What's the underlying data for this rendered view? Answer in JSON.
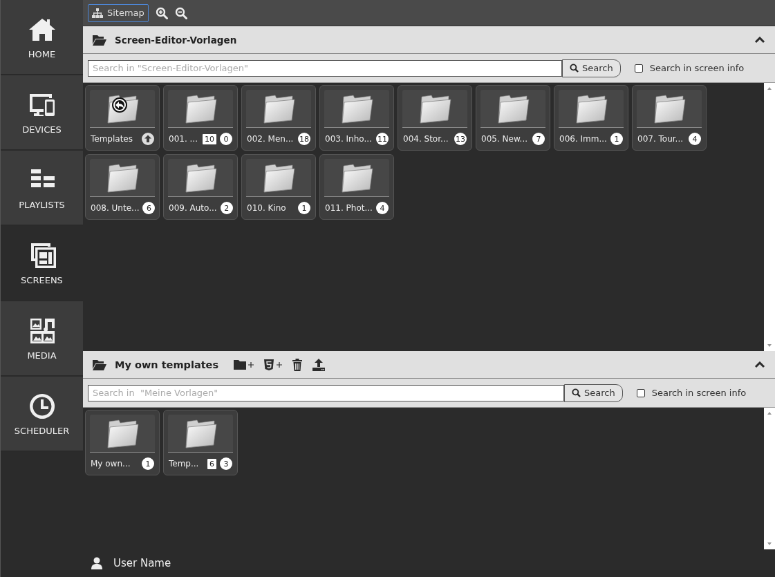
{
  "sidebar": {
    "items": [
      {
        "label": "HOME",
        "selected": false
      },
      {
        "label": "DEVICES",
        "selected": false
      },
      {
        "label": "PLAYLISTS",
        "selected": false
      },
      {
        "label": "SCREENS",
        "selected": true
      },
      {
        "label": "MEDIA",
        "selected": false
      },
      {
        "label": "SCHEDULER",
        "selected": false
      }
    ]
  },
  "toolbar": {
    "sitemap_label": "Sitemap"
  },
  "panels": [
    {
      "title": "Screen-Editor-Vorlagen",
      "editable": false,
      "placeholder": "Search in \"Screen-Editor-Vorlagen\"",
      "search_label": "Search",
      "checkbox_label": "Search in screen info",
      "checked": false,
      "folders": [
        {
          "kind": "parent",
          "name": "Templates"
        },
        {
          "kind": "folder",
          "name": "001. ...",
          "subfolders": "10",
          "count": "0"
        },
        {
          "kind": "folder",
          "name": "002. Men...",
          "count": "18"
        },
        {
          "kind": "folder",
          "name": "003. Inho...",
          "count": "11"
        },
        {
          "kind": "folder",
          "name": "004. Stor...",
          "count": "13"
        },
        {
          "kind": "folder",
          "name": "005. New...",
          "count": "7"
        },
        {
          "kind": "folder",
          "name": "006. Imm...",
          "count": "1"
        },
        {
          "kind": "folder",
          "name": "007. Tour...",
          "count": "4"
        },
        {
          "kind": "folder",
          "name": "008. Unte...",
          "count": "6"
        },
        {
          "kind": "folder",
          "name": "009. Auto...",
          "count": "2"
        },
        {
          "kind": "folder",
          "name": "010. Kino",
          "count": "1"
        },
        {
          "kind": "folder",
          "name": "011. Phot...",
          "count": "4"
        }
      ]
    },
    {
      "title": "My own templates",
      "editable": true,
      "placeholder": "Search in  \"Meine Vorlagen\"",
      "search_label": "Search",
      "checkbox_label": "Search in screen info",
      "checked": false,
      "folders": [
        {
          "kind": "folder",
          "name": "My own...",
          "count": "1"
        },
        {
          "kind": "folder",
          "name": "Temp...",
          "subfolders": "6",
          "count": "3"
        }
      ]
    }
  ],
  "user": {
    "name": "User Name"
  }
}
